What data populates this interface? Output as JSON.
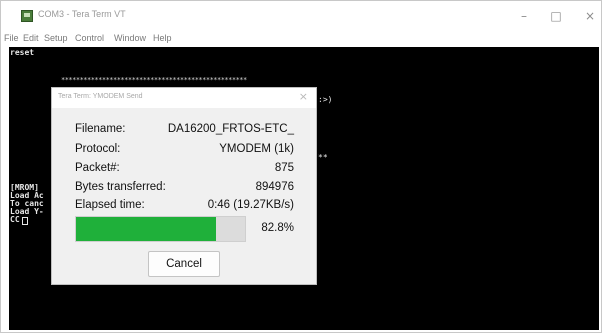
{
  "window": {
    "title": "COM3 - Tera Term VT",
    "controls": {
      "minimize": "–",
      "maximize": "□",
      "close": "×"
    }
  },
  "menu": [
    "File",
    "Edit",
    "Setup",
    "Control",
    "Window",
    "Help"
  ],
  "terminal": {
    "line1": "reset",
    "stars": "**************************************************",
    "frag_right1": ":>)",
    "frag_right2": "**",
    "left_lines": [
      "[MROM]",
      "Load Ac",
      "To canc",
      "Load Y-",
      "CC"
    ]
  },
  "dialog": {
    "title": "Tera Term: YMODEM Send",
    "close_glyph": "×",
    "rows": [
      {
        "label": "Filename:",
        "value": "DA16200_FRTOS-ETC_"
      },
      {
        "label": "Protocol:",
        "value": "YMODEM (1k)"
      },
      {
        "label": "Packet#:",
        "value": "875"
      },
      {
        "label": "Bytes transferred:",
        "value": "894976"
      },
      {
        "label": "Elapsed time:",
        "value": "0:46 (19.27KB/s)"
      }
    ],
    "progress": {
      "percent_text": "82.8%",
      "fraction": 0.828,
      "fill_color": "#1fb03a"
    },
    "cancel_label": "Cancel"
  }
}
